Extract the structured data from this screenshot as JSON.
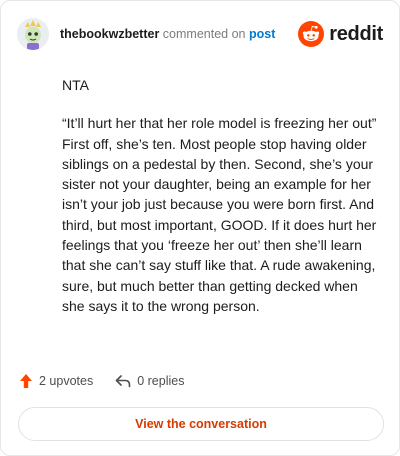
{
  "header": {
    "username": "thebookwzbetter",
    "action_text": "commented on",
    "post_link": "post",
    "brand": "reddit"
  },
  "comment": {
    "paragraphs": [
      "NTA",
      "“It’ll hurt her that her role model is freezing her out” First off, she’s ten. Most people stop having older siblings on a pedestal by then. Second, she’s your sister not your daughter, being an example for her isn’t your job just because you were born first. And third, but most important, GOOD. If it does hurt her feelings that you ‘freeze her out’ then she’ll learn that she can’t say stuff like that. A rude awakening, sure, but much better than getting decked when she says it to the wrong person."
    ]
  },
  "actions": {
    "upvotes": "2 upvotes",
    "replies": "0 replies"
  },
  "cta": {
    "label": "View the conversation"
  },
  "colors": {
    "brand_orange": "#ff4500",
    "link_blue": "#0079d3",
    "cta_text": "#d93a00"
  },
  "icons": {
    "avatar": "avatar",
    "logo": "reddit-alien-icon",
    "upvote": "upvote-arrow-icon",
    "reply": "reply-arrow-icon"
  }
}
